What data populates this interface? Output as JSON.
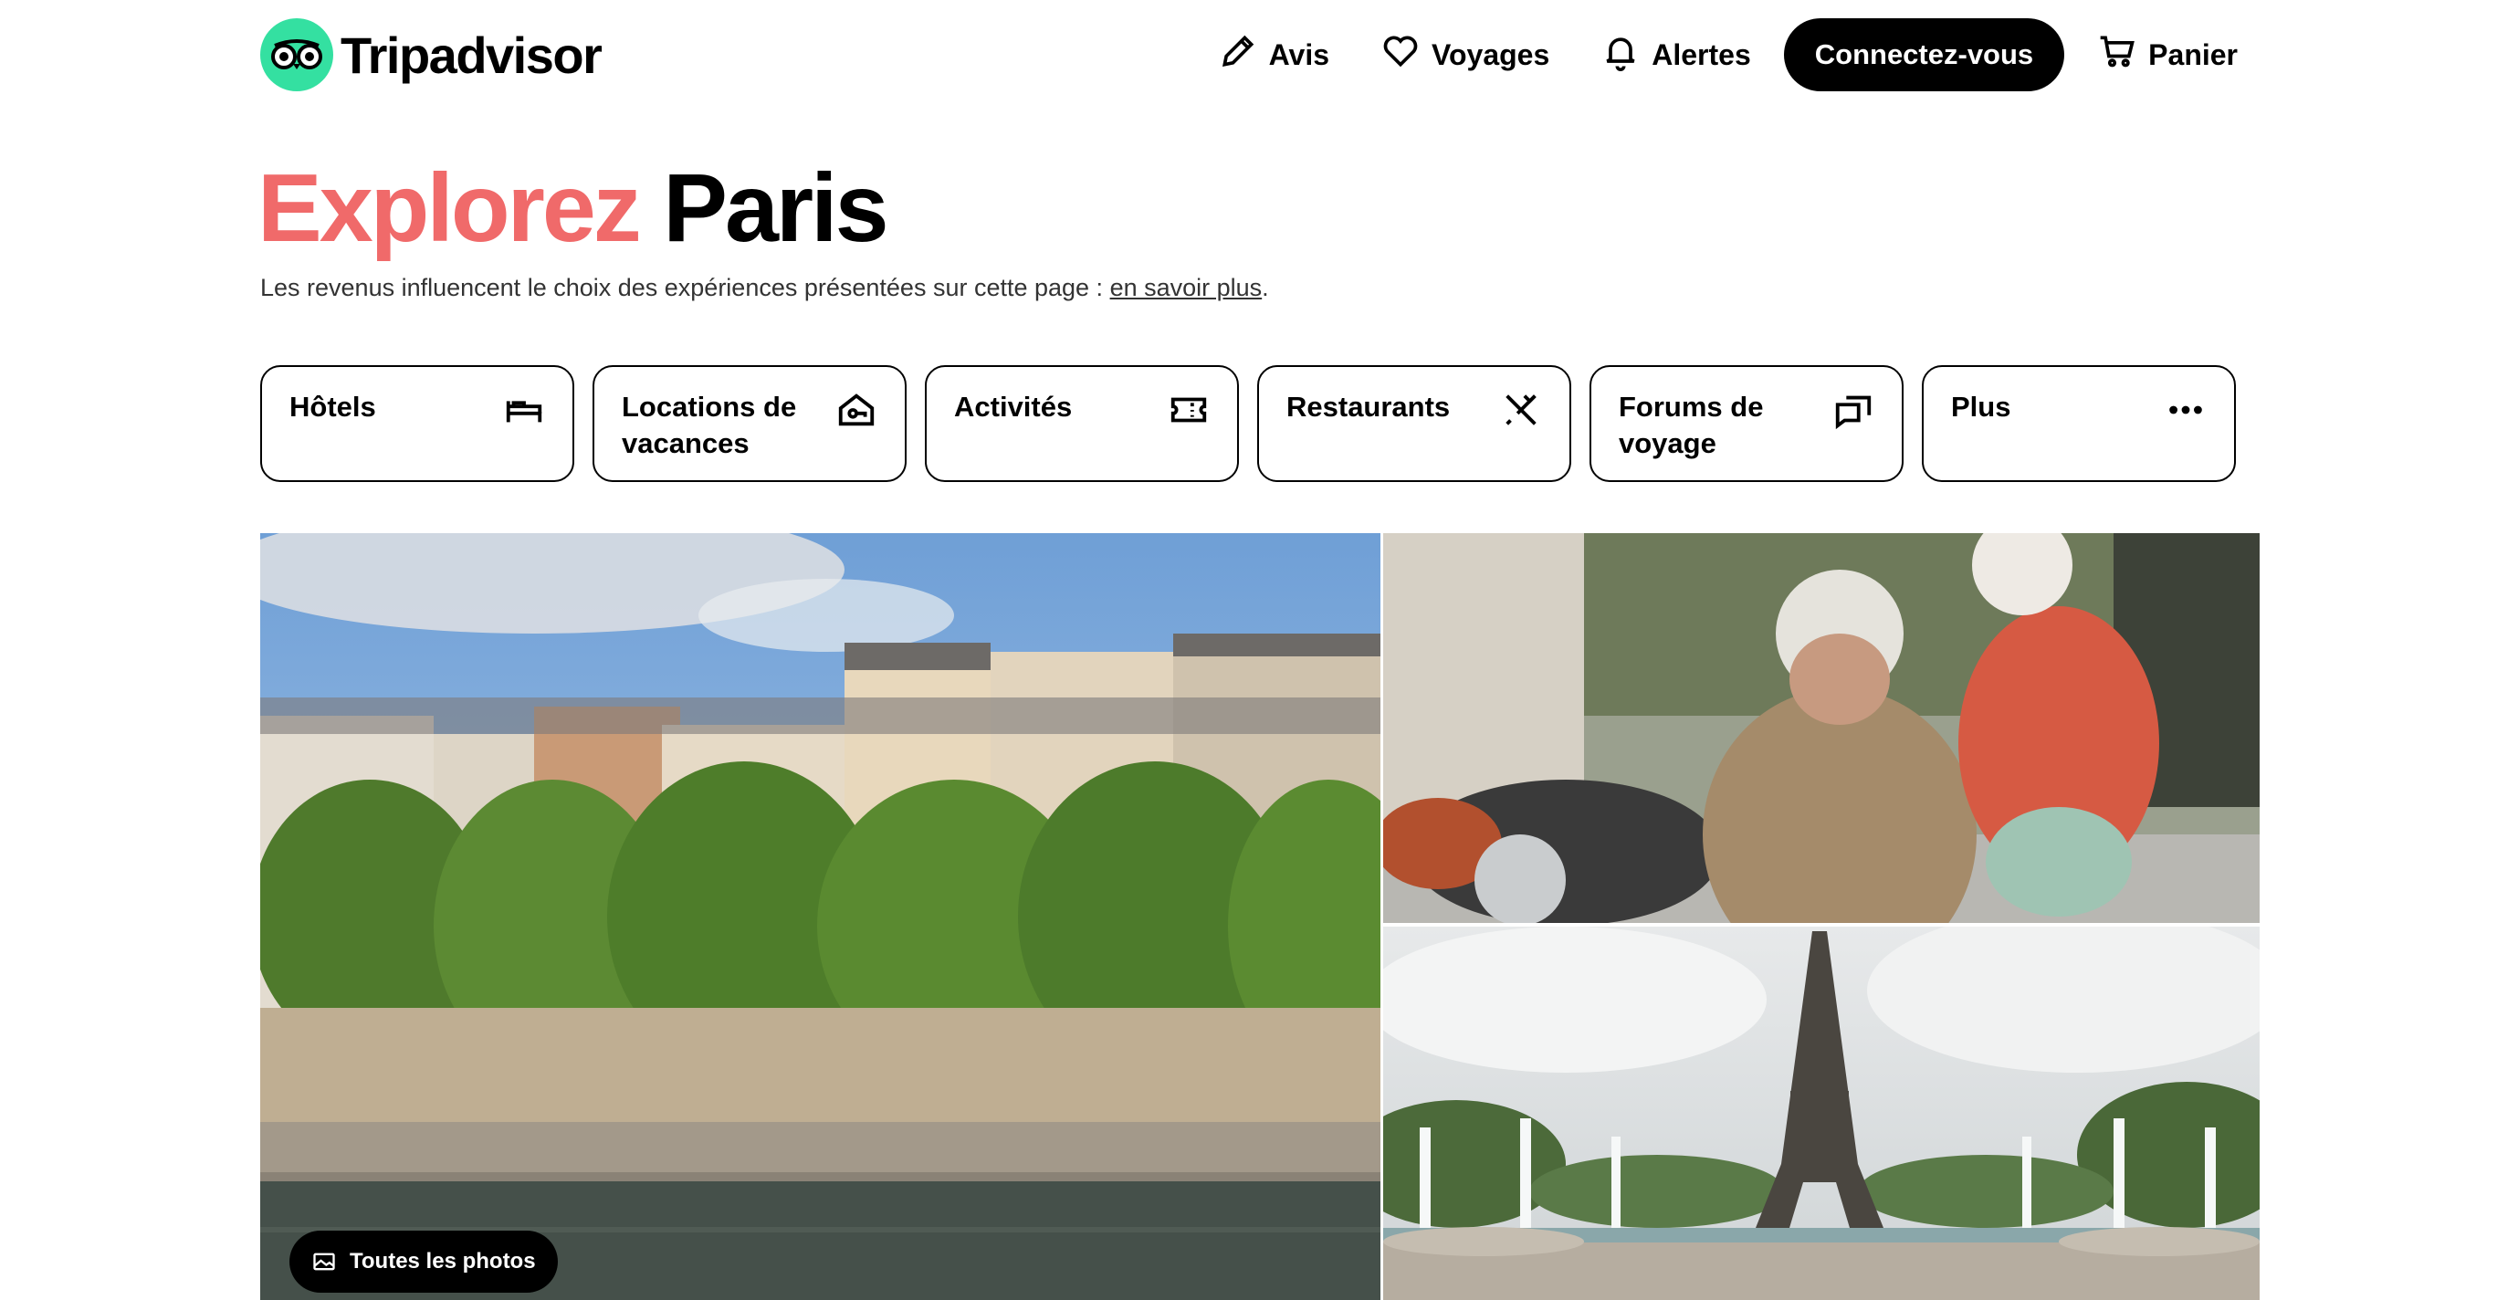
{
  "header": {
    "logo_text": "Tripadvisor",
    "nav": {
      "reviews": "Avis",
      "trips": "Voyages",
      "alerts": "Alertes",
      "login": "Connectez-vous",
      "cart": "Panier"
    }
  },
  "hero": {
    "title_accent": "Explorez",
    "title_city": "Paris",
    "disclaimer": "Les revenus influencent le choix des expériences présentées sur cette page : ",
    "disclaimer_link": "en savoir plus",
    "disclaimer_end": "."
  },
  "categories": [
    {
      "label": "Hôtels",
      "icon": "bed-icon"
    },
    {
      "label": "Locations de vacances",
      "icon": "house-key-icon"
    },
    {
      "label": "Activités",
      "icon": "ticket-icon"
    },
    {
      "label": "Restaurants",
      "icon": "fork-knife-icon"
    },
    {
      "label": "Forums de voyage",
      "icon": "chat-bubbles-icon"
    },
    {
      "label": "Plus",
      "icon": "more-dots-icon"
    }
  ],
  "gallery": {
    "all_photos": "Toutes les photos"
  },
  "colors": {
    "accent": "#f06a6a",
    "brand_green": "#34e0a1"
  }
}
